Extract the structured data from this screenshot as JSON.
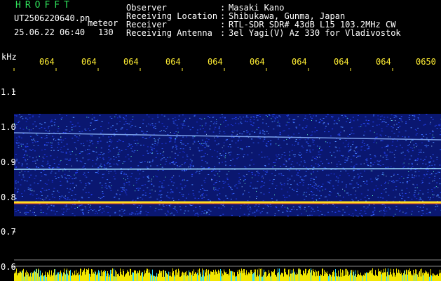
{
  "header": {
    "app_title": "HROFFT",
    "filename": "UT2506220640.pn",
    "tag": "meteor",
    "date": "25.06.22 06:40",
    "count": "130"
  },
  "info": [
    {
      "label": "Observer",
      "value": "Masaki Kano"
    },
    {
      "label": "Receiving Location",
      "value": "Shibukawa, Gunma, Japan"
    },
    {
      "label": "Receiver",
      "value": "RTL-SDR SDR# 43dB L15 103.2MHz CW"
    },
    {
      "label": "Receiving Antenna",
      "value": "3el Yagi(V) Az 330 for Vladivostok"
    }
  ],
  "axis": {
    "unit": "kHz",
    "y_ticks": [
      "1.1",
      "1.0",
      "0.9",
      "0.8",
      "0.7",
      "0.6"
    ],
    "time_ticks": [
      "064",
      "064",
      "064",
      "064",
      "064",
      "064",
      "064",
      "064",
      "064",
      "0650"
    ]
  },
  "colors": {
    "title": "#2ee05a",
    "info_text": "#ffffff",
    "time_labels": "#ffee33",
    "waterfall_bg": "#0b1a8c"
  }
}
